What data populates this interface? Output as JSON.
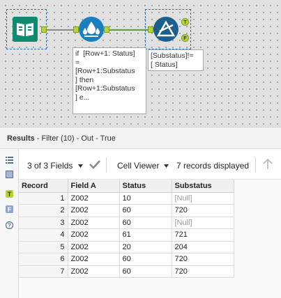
{
  "canvas": {
    "annotations": {
      "formula": "if  [Row+1: Status]\n=\n[Row+1:Substatus\n] then\n[Row+1:Substatus\n] e...",
      "filter": "[Substatus]!=\n[ Status]"
    },
    "badges": {
      "true": "T",
      "false": "F"
    }
  },
  "results": {
    "label": "Results",
    "path": " - Filter (10) - Out - True"
  },
  "toolbar": {
    "fields": "3 of 3 Fields",
    "viewer": "Cell Viewer",
    "records": "7 records displayed"
  },
  "table": {
    "columns": [
      "Record",
      "Field A",
      "Status",
      "Substatus"
    ],
    "rows": [
      [
        "1",
        "Z002",
        "10",
        "[Null]"
      ],
      [
        "2",
        "Z002",
        "60",
        "720"
      ],
      [
        "3",
        "Z002",
        "60",
        "[Null]"
      ],
      [
        "4",
        "Z002",
        "61",
        "721"
      ],
      [
        "5",
        "Z002",
        "20",
        "204"
      ],
      [
        "6",
        "Z002",
        "60",
        "720"
      ],
      [
        "7",
        "Z002",
        "60",
        "720"
      ]
    ]
  },
  "colors": {
    "input_tool": "#0f8a6e",
    "formula_tool": "#1a7fbf",
    "filter_tool": "#1c5f8c",
    "anchor": "#b5d33d"
  }
}
